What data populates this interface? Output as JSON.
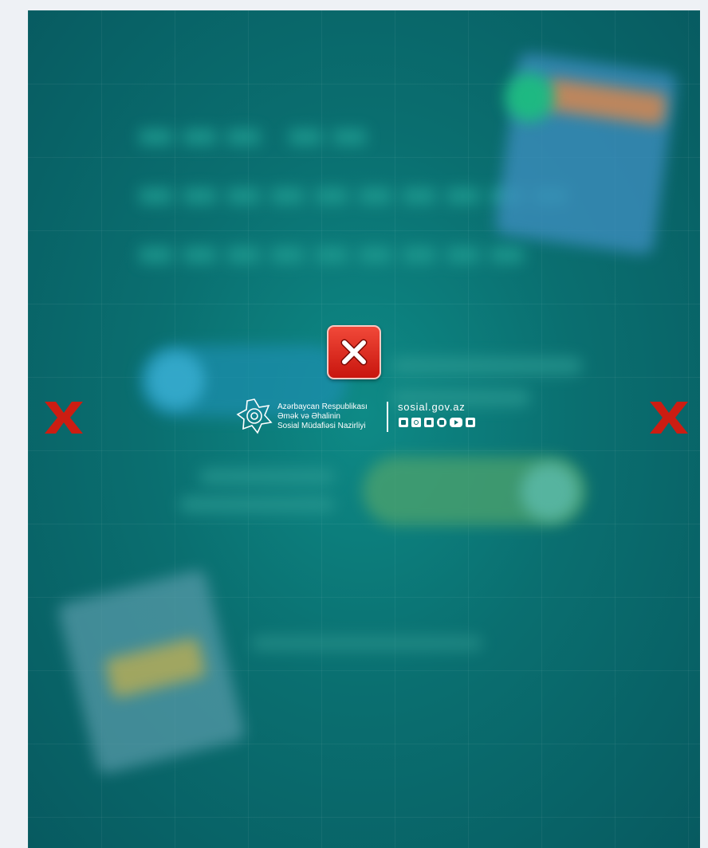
{
  "popup": {
    "close_button_label": "",
    "side_close_label": "",
    "colors": {
      "close_red": "#d11a10",
      "x_red": "#cc1d12",
      "banner_teal": "#0a6f70"
    }
  },
  "logo": {
    "ministry_lines": [
      "Azərbaycan Respublikası",
      "Əmək və Əhalinin",
      "Sosial Müdafiəsi Nazirliyi"
    ],
    "website": "sosial.gov.az",
    "social_icons": [
      "facebook-icon",
      "instagram-icon",
      "telegram-icon",
      "x-twitter-icon",
      "youtube-icon",
      "linkedin-icon"
    ]
  }
}
